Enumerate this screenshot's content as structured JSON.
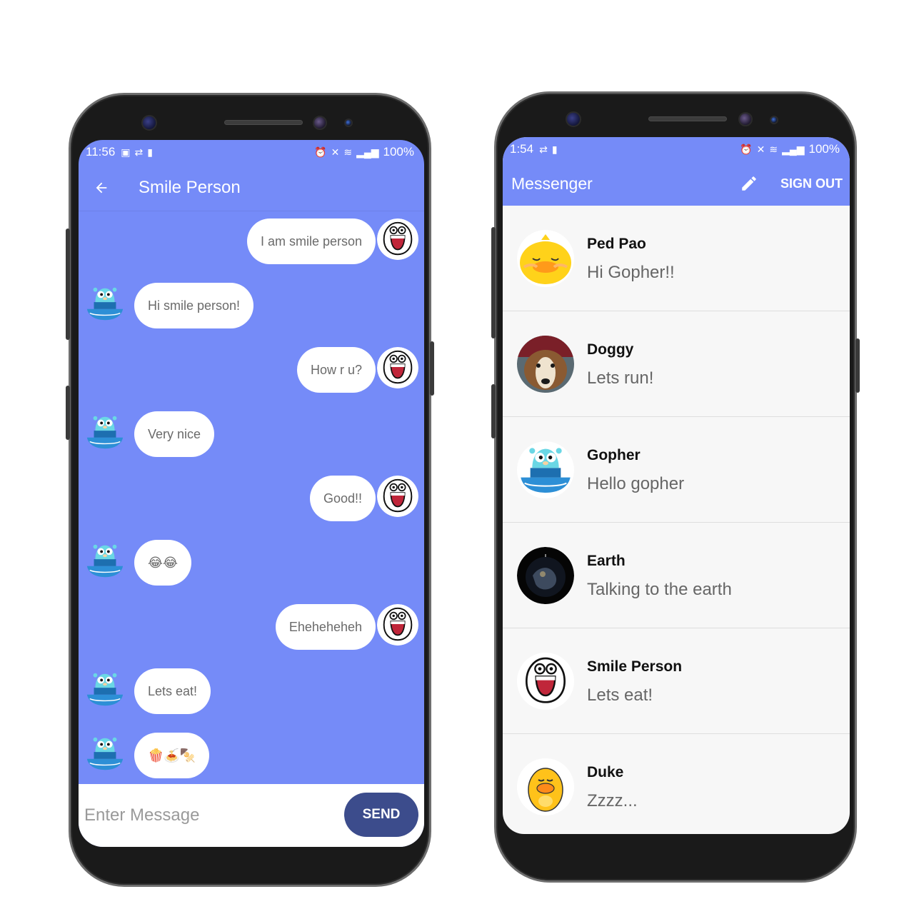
{
  "chat_screen": {
    "status": {
      "time": "11:56",
      "battery": "100%"
    },
    "title": "Smile Person",
    "messages": [
      {
        "sender": "Smile Person",
        "text": "I am smile person"
      },
      {
        "sender": "Gopher",
        "text": "Hi smile person!"
      },
      {
        "sender": "Smile Person",
        "text": "How r u?"
      },
      {
        "sender": "Gopher",
        "text": "Very nice"
      },
      {
        "sender": "Smile Person",
        "text": "Good!!"
      },
      {
        "sender": "Gopher",
        "text": "😂😂"
      },
      {
        "sender": "Smile Person",
        "text": "Eheheheheh"
      },
      {
        "sender": "Gopher",
        "text": "Lets eat!"
      },
      {
        "sender": "Gopher",
        "text": "🍿🍝🍢"
      }
    ],
    "input_placeholder": "Enter Message",
    "send_label": "SEND"
  },
  "messenger_screen": {
    "status": {
      "time": "1:54",
      "battery": "100%"
    },
    "title": "Messenger",
    "sign_out_label": "SIGN OUT",
    "conversations": [
      {
        "name": "Ped Pao",
        "last_message": "Hi Gopher!!",
        "avatar": "yellow-chick-avatar"
      },
      {
        "name": "Doggy",
        "last_message": "Lets run!",
        "avatar": "dog-photo-avatar"
      },
      {
        "name": "Gopher",
        "last_message": "Hello gopher",
        "avatar": "gopher-avatar"
      },
      {
        "name": "Earth",
        "last_message": "Talking to the earth",
        "avatar": "earth-avatar"
      },
      {
        "name": "Smile Person",
        "last_message": "Lets eat!",
        "avatar": "smile-face-avatar"
      },
      {
        "name": "Duke",
        "last_message": "Zzzz...",
        "avatar": "duck-avatar"
      }
    ]
  },
  "colors": {
    "primary": "#758bf8",
    "send_button": "#3c4c8c",
    "bubble": "#ffffff",
    "list_background": "#f7f7f7"
  }
}
